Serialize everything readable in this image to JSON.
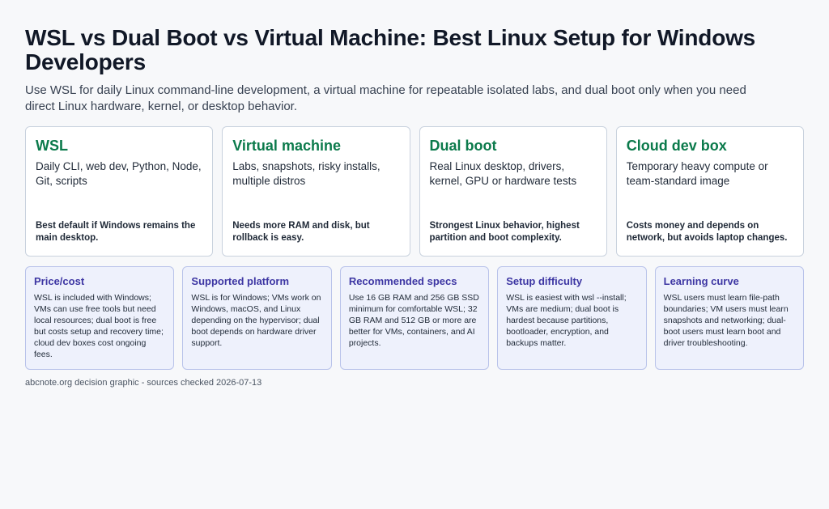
{
  "header": {
    "title": "WSL vs Dual Boot vs Virtual Machine: Best Linux Setup for Windows Developers",
    "subtitle": "Use WSL for daily Linux command-line development, a virtual machine for repeatable isolated labs, and dual boot only when you need direct Linux hardware, kernel, or desktop behavior."
  },
  "options": [
    {
      "title": "WSL",
      "desc": "Daily CLI, web dev, Python, Node, Git, scripts",
      "note": "Best default if Windows remains the main desktop."
    },
    {
      "title": "Virtual machine",
      "desc": "Labs, snapshots, risky installs, multiple distros",
      "note": "Needs more RAM and disk, but rollback is easy."
    },
    {
      "title": "Dual boot",
      "desc": "Real Linux desktop, drivers, kernel, GPU or hardware tests",
      "note": "Strongest Linux behavior, highest partition and boot complexity."
    },
    {
      "title": "Cloud dev box",
      "desc": "Temporary heavy compute or team-standard image",
      "note": "Costs money and depends on network, but avoids laptop changes."
    }
  ],
  "factors": [
    {
      "title": "Price/cost",
      "body": "WSL is included with Windows; VMs can use free tools but need local resources; dual boot is free but costs setup and recovery time; cloud dev boxes cost ongoing fees."
    },
    {
      "title": "Supported platform",
      "body": "WSL is for Windows; VMs work on Windows, macOS, and Linux depending on the hypervisor; dual boot depends on hardware driver support."
    },
    {
      "title": "Recommended specs",
      "body": "Use 16 GB RAM and 256 GB SSD minimum for comfortable WSL; 32 GB RAM and 512 GB or more are better for VMs, containers, and AI projects."
    },
    {
      "title": "Setup difficulty",
      "body": "WSL is easiest with wsl --install; VMs are medium; dual boot is hardest because partitions, bootloader, encryption, and backups matter."
    },
    {
      "title": "Learning curve",
      "body": "WSL users must learn file-path boundaries; VM users must learn snapshots and networking; dual-boot users must learn boot and driver troubleshooting."
    }
  ],
  "footer": {
    "text": "abcnote.org decision graphic - sources checked 2026-07-13"
  },
  "colors": {
    "option_title": "#0b7a4b",
    "factor_title": "#3d36a3",
    "factor_bg": "#eef1fc",
    "page_bg": "#f7f8fa"
  }
}
